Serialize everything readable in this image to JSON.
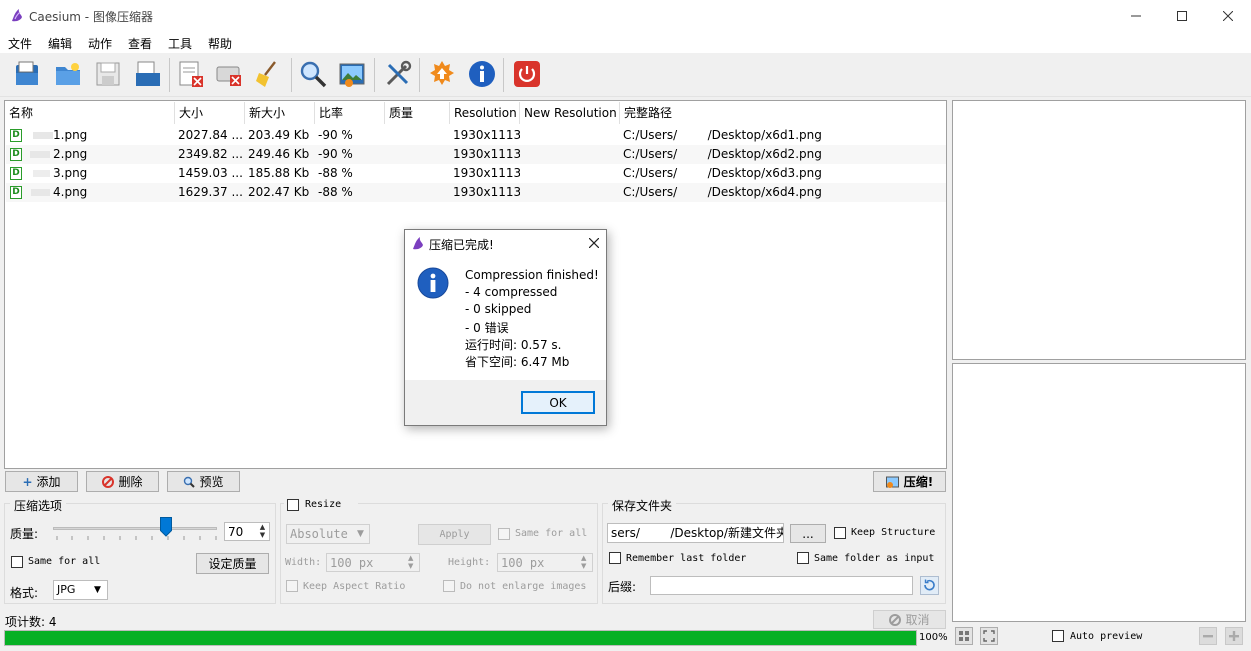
{
  "window": {
    "title": "Caesium - 图像压缩器"
  },
  "menu": [
    "文件",
    "编辑",
    "动作",
    "查看",
    "工具",
    "帮助"
  ],
  "list": {
    "columns": [
      "名称",
      "大小",
      "新大小",
      "比率",
      "质量",
      "Resolution",
      "New Resolution",
      "完整路径"
    ],
    "rows": [
      {
        "name": "1.png",
        "size": "2027.84 ...",
        "new_size": "203.49 Kb",
        "ratio": "-90 %",
        "quality": "",
        "resolution": "1930x1113",
        "new_resolution": "",
        "path": "C:/Users/        /Desktop/x6d1.png"
      },
      {
        "name": "2.png",
        "size": "2349.82 ...",
        "new_size": "249.46 Kb",
        "ratio": "-90 %",
        "quality": "",
        "resolution": "1930x1113",
        "new_resolution": "",
        "path": "C:/Users/        /Desktop/x6d2.png"
      },
      {
        "name": "3.png",
        "size": "1459.03 ...",
        "new_size": "185.88 Kb",
        "ratio": "-88 %",
        "quality": "",
        "resolution": "1930x1113",
        "new_resolution": "",
        "path": "C:/Users/        /Desktop/x6d3.png"
      },
      {
        "name": "4.png",
        "size": "1629.37 ...",
        "new_size": "202.47 Kb",
        "ratio": "-88 %",
        "quality": "",
        "resolution": "1930x1113",
        "new_resolution": "",
        "path": "C:/Users/        /Desktop/x6d4.png"
      }
    ],
    "file_badge": "D"
  },
  "actions": {
    "add": "添加",
    "delete": "删除",
    "preview": "预览",
    "compress": "压缩!"
  },
  "compression": {
    "group_title": "压缩选项",
    "quality_label": "质量:",
    "quality_value": "70",
    "same_for_all": "Same for all",
    "set_quality": "设定质量",
    "format_label": "格式:",
    "format_value": "JPG"
  },
  "resize": {
    "title": "Resize",
    "mode": "Absolute",
    "apply": "Apply",
    "same_for_all": "Same for all",
    "width_label": "Width:",
    "width_value": "100 px",
    "height_label": "Height:",
    "height_value": "100 px",
    "keep_aspect": "Keep Aspect Ratio",
    "no_enlarge": "Do not enlarge images"
  },
  "output": {
    "group_title": "保存文件夹",
    "folder_value": "sers/        /Desktop/新建文件夹",
    "browse": "...",
    "keep_structure": "Keep Structure",
    "remember_last": "Remember last folder",
    "same_folder": "Same folder as input",
    "suffix_label": "后缀:",
    "suffix_value": ""
  },
  "status": {
    "item_count": "项计数: 4",
    "cancel": "取消",
    "progress_text": "100%",
    "progress": 1.0
  },
  "preview": {
    "auto_preview": "Auto preview"
  },
  "dialog": {
    "title": "压缩已完成!",
    "lines": [
      "Compression finished!",
      "- 4 compressed",
      "- 0 skipped",
      "- 0 错误",
      "运行时间: 0.57 s.",
      "省下空间: 6.47 Mb"
    ],
    "ok": "OK"
  },
  "colors": {
    "progress": "#06b025",
    "accent": "#0078d7",
    "info": "#1f5fbf",
    "danger": "#d9342b"
  }
}
